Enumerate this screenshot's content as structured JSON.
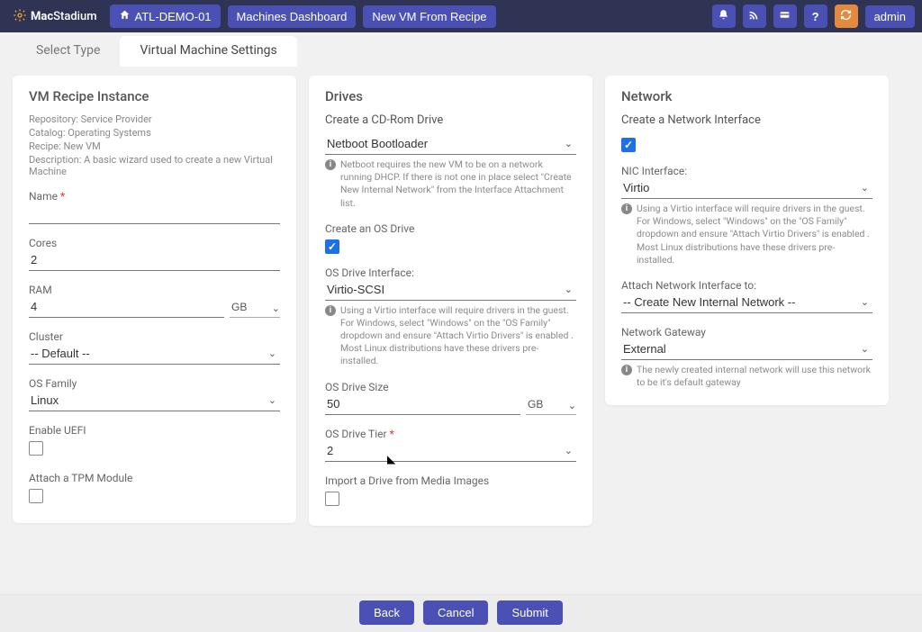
{
  "brand": {
    "bold": "Mac",
    "rest": "Stadium"
  },
  "nav": {
    "home": "ATL-DEMO-01",
    "dashboard": "Machines Dashboard",
    "newvm": "New VM From Recipe",
    "admin": "admin"
  },
  "icons": {
    "bell": "bell-icon",
    "rss": "rss-icon",
    "card": "card-icon",
    "help": "help-icon",
    "refresh": "refresh-icon",
    "home": "home-icon"
  },
  "tabs": {
    "select_type": "Select Type",
    "vm_settings": "Virtual Machine Settings"
  },
  "recipe": {
    "title": "VM Recipe Instance",
    "repo_lbl": "Repository:",
    "repo_val": "Service Provider",
    "catalog_lbl": "Catalog:",
    "catalog_val": "Operating Systems",
    "recipe_lbl": "Recipe:",
    "recipe_val": "New VM",
    "desc_lbl": "Description:",
    "desc_val": "A basic wizard used to create a new Virtual Machine",
    "name_lbl": "Name",
    "name_val": "",
    "cores_lbl": "Cores",
    "cores_val": "2",
    "ram_lbl": "RAM",
    "ram_val": "4",
    "ram_unit": "GB",
    "cluster_lbl": "Cluster",
    "cluster_val": "-- Default --",
    "osfamily_lbl": "OS Family",
    "osfamily_val": "Linux",
    "uefi_lbl": "Enable UEFI",
    "tpm_lbl": "Attach a TPM Module"
  },
  "drives": {
    "title": "Drives",
    "cdrom_lbl": "Create a CD-Rom Drive",
    "cdrom_val": "Netboot Bootloader",
    "cdrom_note": "Netboot requires the new VM to be on a network running DHCP. If there is not one in place select \"Create New Internal Network\" from the Interface Attachment list.",
    "osdrive_lbl": "Create an OS Drive",
    "osiface_lbl": "OS Drive Interface:",
    "osiface_val": "Virtio-SCSI",
    "osiface_note": "Using a Virtio interface will require drivers in the guest. For Windows, select \"Windows\" on the \"OS Family\" dropdown and ensure \"Attach Virtio Drivers\" is enabled . Most Linux distributions have these drivers pre-installed.",
    "ossize_lbl": "OS Drive Size",
    "ossize_val": "50",
    "ossize_unit": "GB",
    "ostier_lbl": "OS Drive Tier",
    "ostier_val": "2",
    "import_lbl": "Import a Drive from Media Images"
  },
  "network": {
    "title": "Network",
    "create_lbl": "Create a Network Interface",
    "nic_lbl": "NIC Interface:",
    "nic_val": "Virtio",
    "nic_note": "Using a Virtio interface will require drivers in the guest. For Windows, select \"Windows\" on the \"OS Family\" dropdown and ensure \"Attach Virtio Drivers\" is enabled . Most Linux distributions have these drivers pre-installed.",
    "attach_lbl": "Attach Network Interface to:",
    "attach_val": "-- Create New Internal Network --",
    "gateway_lbl": "Network Gateway",
    "gateway_val": "External",
    "gateway_note": "The newly created internal network will use this network to be it's default gateway"
  },
  "footer": {
    "back": "Back",
    "cancel": "Cancel",
    "submit": "Submit"
  }
}
